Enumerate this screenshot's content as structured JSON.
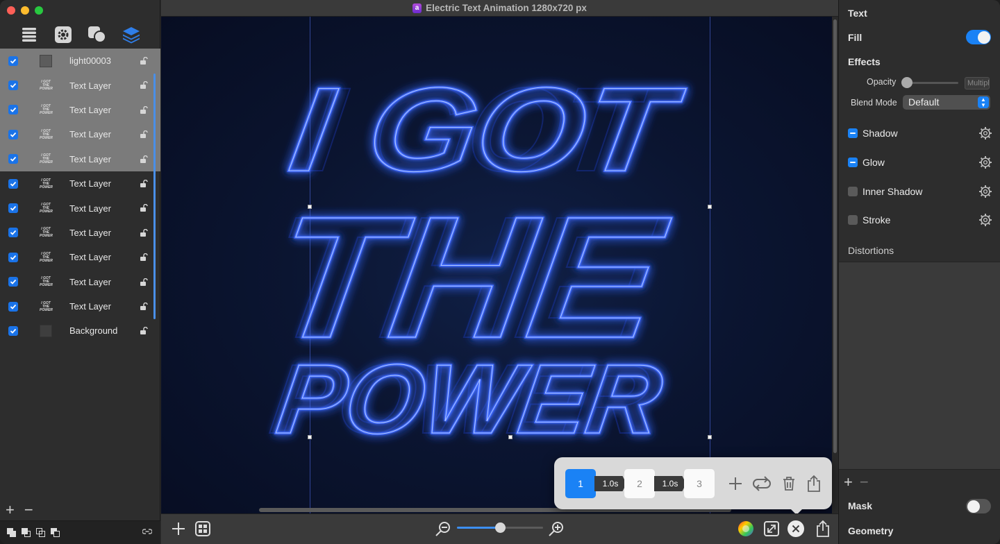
{
  "window": {
    "title": "Electric Text Animation 1280x720 px",
    "app_icon_letter": "a"
  },
  "sidebar": {
    "tools": [
      "list-icon",
      "gear-icon",
      "shapes-icon",
      "layers-icon"
    ],
    "layers": [
      {
        "name": "light00003",
        "thumb": "gray",
        "selected": true
      },
      {
        "name": "Text Layer",
        "thumb": "text",
        "selected": true
      },
      {
        "name": "Text Layer",
        "thumb": "text",
        "selected": true
      },
      {
        "name": "Text Layer",
        "thumb": "text",
        "selected": true
      },
      {
        "name": "Text Layer",
        "thumb": "text",
        "selected": true
      },
      {
        "name": "Text Layer",
        "thumb": "text",
        "selected": false
      },
      {
        "name": "Text Layer",
        "thumb": "text",
        "selected": false
      },
      {
        "name": "Text Layer",
        "thumb": "text",
        "selected": false
      },
      {
        "name": "Text Layer",
        "thumb": "text",
        "selected": false
      },
      {
        "name": "Text Layer",
        "thumb": "text",
        "selected": false
      },
      {
        "name": "Text Layer",
        "thumb": "text",
        "selected": false
      },
      {
        "name": "Background",
        "thumb": "dark",
        "selected": false
      }
    ],
    "thumb_text": [
      "I GOT",
      "THE",
      "POWER"
    ],
    "add_label": "+",
    "remove_label": "−"
  },
  "canvas": {
    "lines": [
      "I GOT",
      "THE",
      "POWER"
    ],
    "neon_color": "#1f4bff",
    "background_color": "#0b1531"
  },
  "keyframes": {
    "frames": [
      {
        "label": "1",
        "active": true
      },
      {
        "label": "2",
        "active": false
      },
      {
        "label": "3",
        "active": false
      }
    ],
    "durations": [
      "1.0s",
      "1.0s"
    ]
  },
  "inspector": {
    "section_title": "Text",
    "fill_label": "Fill",
    "fill_on": true,
    "effects_label": "Effects",
    "opacity_label": "Opacity",
    "opacity_value": 0,
    "opacity_field": "Multiply",
    "blend_label": "Blend Mode",
    "blend_value": "Default",
    "effects": [
      {
        "name": "Shadow",
        "enabled": true
      },
      {
        "name": "Glow",
        "enabled": true
      },
      {
        "name": "Inner Shadow",
        "enabled": false
      },
      {
        "name": "Stroke",
        "enabled": false
      }
    ],
    "distortions_label": "Distortions",
    "mask_label": "Mask",
    "mask_on": false,
    "geometry_label": "Geometry",
    "add_label": "+",
    "remove_label": "−"
  },
  "colors": {
    "accent": "#1a82f5",
    "selection": "#7b7b7b"
  }
}
